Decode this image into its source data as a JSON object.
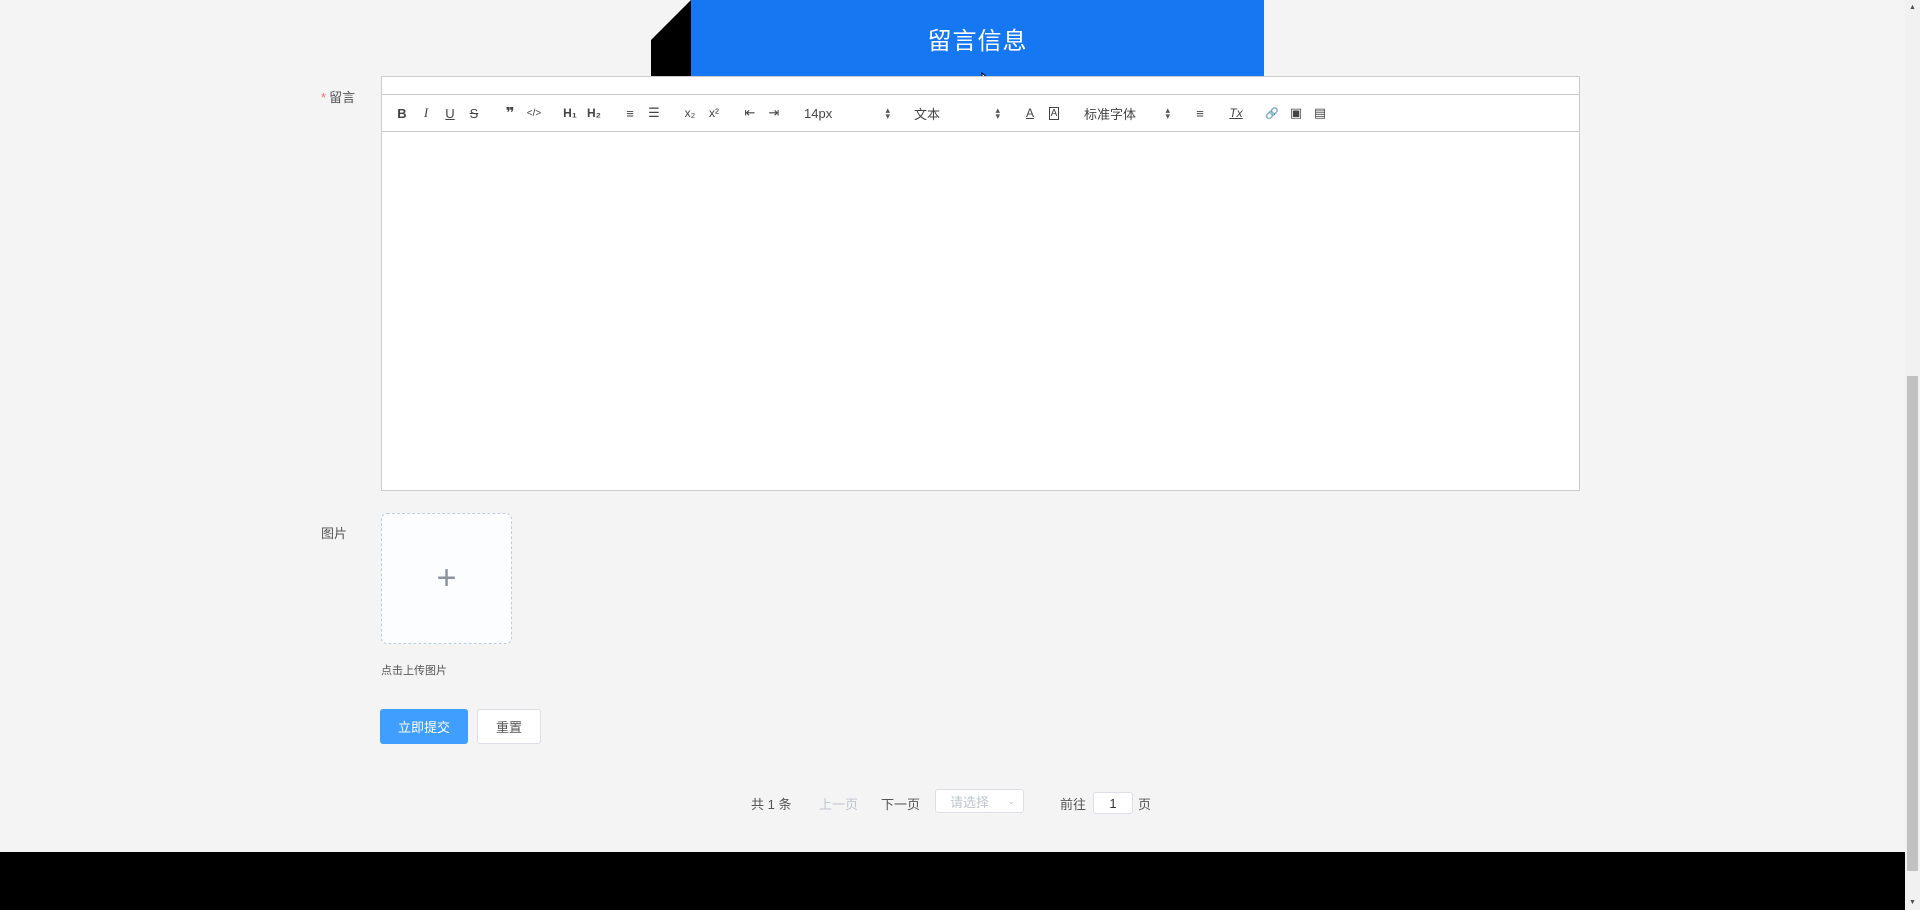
{
  "banner": {
    "title": "留言信息"
  },
  "form": {
    "message_label": "留言",
    "required_mark": "*",
    "image_label": "图片",
    "upload_tip": "点击上传图片",
    "upload_plus": "+",
    "submit_label": "立即提交",
    "reset_label": "重置"
  },
  "toolbar": {
    "bold": "B",
    "italic": "I",
    "underline": "U",
    "strike": "S",
    "quote": "❞",
    "code": "</>",
    "h1": "H₁",
    "h2": "H₂",
    "ordered_list": "≡",
    "bullet_list": "☰",
    "subscript": "x₂",
    "superscript": "x²",
    "outdent": "⇤",
    "indent": "⇥",
    "size_value": "14px",
    "header_value": "文本",
    "color": "A",
    "background": "A",
    "font_value": "标准字体",
    "align": "≡",
    "clean": "Tx",
    "link": "🔗",
    "image": "▣",
    "video": "▤"
  },
  "pagination": {
    "total": "共 1 条",
    "prev": "上一页",
    "next": "下一页",
    "page_size_placeholder": "请选择",
    "goto_prefix": "前往",
    "goto_value": "1",
    "goto_suffix": "页"
  }
}
